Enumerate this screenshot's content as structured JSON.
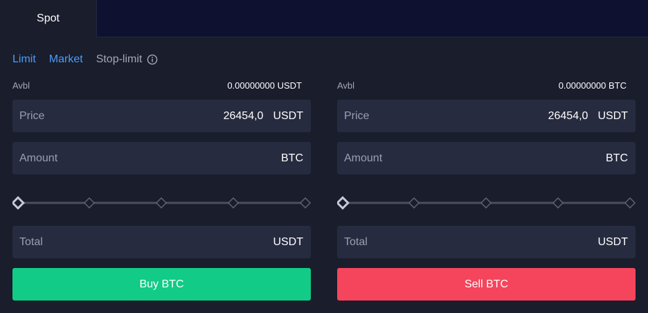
{
  "tabs": {
    "spot": "Spot"
  },
  "order_types": {
    "limit": "Limit",
    "market": "Market",
    "stop_limit": "Stop-limit"
  },
  "buy": {
    "avbl_label": "Avbl",
    "avbl_value": "0.00000000 USDT",
    "price_label": "Price",
    "price_value": "26454,0",
    "price_unit": "USDT",
    "amount_label": "Amount",
    "amount_unit": "BTC",
    "slider_percent": 0,
    "total_label": "Total",
    "total_unit": "USDT",
    "button_label": "Buy BTC"
  },
  "sell": {
    "avbl_label": "Avbl",
    "avbl_value": "0.00000000 BTC",
    "price_label": "Price",
    "price_value": "26454,0",
    "price_unit": "USDT",
    "amount_label": "Amount",
    "amount_unit": "BTC",
    "slider_percent": 0,
    "total_label": "Total",
    "total_unit": "USDT",
    "button_label": "Sell BTC"
  },
  "colors": {
    "accent": "#4d9cf8",
    "buy": "#12cb86",
    "sell": "#f5455c",
    "background": "#191d2c",
    "field": "#262b3f"
  },
  "icons": {
    "info": "info-circle-icon",
    "slider_handle": "diamond-icon"
  }
}
